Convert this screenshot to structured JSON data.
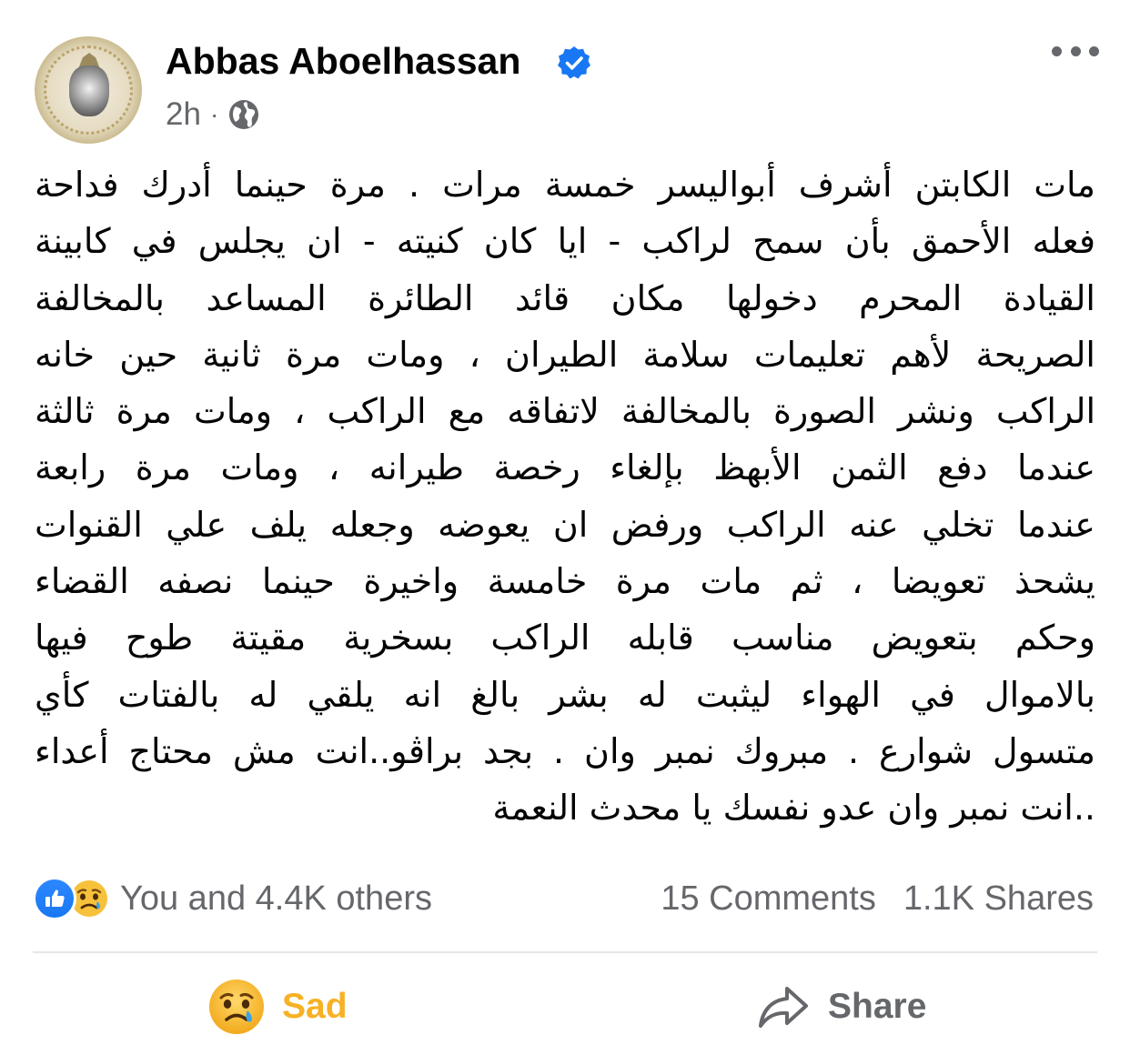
{
  "post": {
    "author": {
      "name": "Abbas Aboelhassan",
      "verified": true,
      "avatar_icon": "profile-avatar"
    },
    "meta": {
      "time": "2h",
      "separator": "·",
      "audience_icon": "globe-icon"
    },
    "text_lines": [
      "مات الكابتن أشرف أبواليسر خمسة مرات . مرة حينما أدرك فداحة",
      "فعله الأحمق بأن سمح لراكب - ايا كان كنيته - ان يجلس في كابينة",
      "القيادة المحرم دخولها مكان قائد الطائرة المساعد بالمخالفة",
      "الصريحة لأهم تعليمات سلامة الطيران ، ومات مرة ثانية حين خانه",
      "الراكب ونشر الصورة بالمخالفة لاتفاقه مع الراكب ، ومات مرة ثالثة",
      "عندما دفع الثمن الأبهظ بإلغاء رخصة طيرانه ، ومات مرة رابعة",
      "عندما تخلي عنه الراكب ورفض ان يعوضه وجعله يلف علي القنوات",
      "يشحذ تعويضا ، ثم مات مرة خامسة واخيرة حينما نصفه القضاء",
      "وحكم بتعويض مناسب قابله الراكب بسخرية مقيتة طوح فيها",
      "بالاموال في الهواء ليثبت له بشر بالغ انه يلقي له بالفتات كأي",
      "متسول شوارع . مبروك نمبر وان . بجد براڤو..انت مش محتاج أعداء",
      "..انت نمبر وان عدو نفسك يا محدث النعمة"
    ]
  },
  "summary": {
    "reaction_icons": [
      "like-icon",
      "sad-icon"
    ],
    "reactions_text": "You and 4.4K others",
    "comments": "15 Comments",
    "shares": "1.1K Shares"
  },
  "actions": {
    "sad_label": "Sad",
    "share_label": "Share"
  },
  "colors": {
    "text": "#050505",
    "secondary": "#65676b",
    "verified_blue": "#1877f2",
    "sad_yellow": "#f7b125",
    "divider": "#e4e6eb"
  }
}
